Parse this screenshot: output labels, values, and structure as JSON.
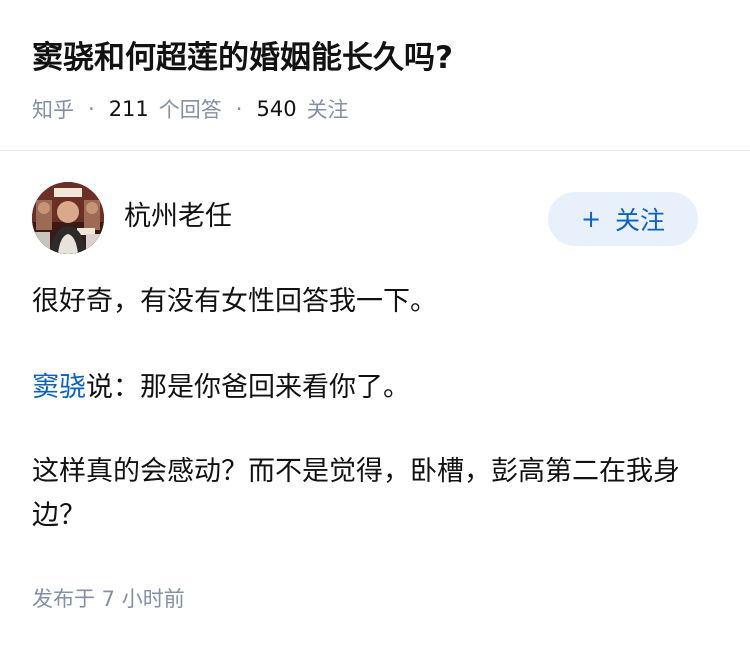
{
  "question": {
    "title": "窦骁和何超莲的婚姻能长久吗?",
    "source": "知乎",
    "separator": "·",
    "answer_count": "211",
    "answer_label": "个回答",
    "follower_count": "540",
    "follower_label": "关注"
  },
  "answer": {
    "author": {
      "name": "杭州老任",
      "avatar_icon": "avatar-photo"
    },
    "follow_button": {
      "icon": "+",
      "label": "关注"
    },
    "paragraphs": {
      "p1": "很好奇，有没有女性回答我一下。",
      "p2_mention": "窦骁",
      "p2_rest": "说：那是你爸回来看你了。",
      "p3": "这样真的会感动？而不是觉得，卧槽，彭高第二在我身边？"
    },
    "publish_time": "发布于 7 小时前"
  },
  "colors": {
    "accent": "#0b62c5",
    "follow_bg": "#e8f0fb",
    "meta_gray": "#8590a6",
    "text": "#121212",
    "divider": "#ebebeb"
  }
}
